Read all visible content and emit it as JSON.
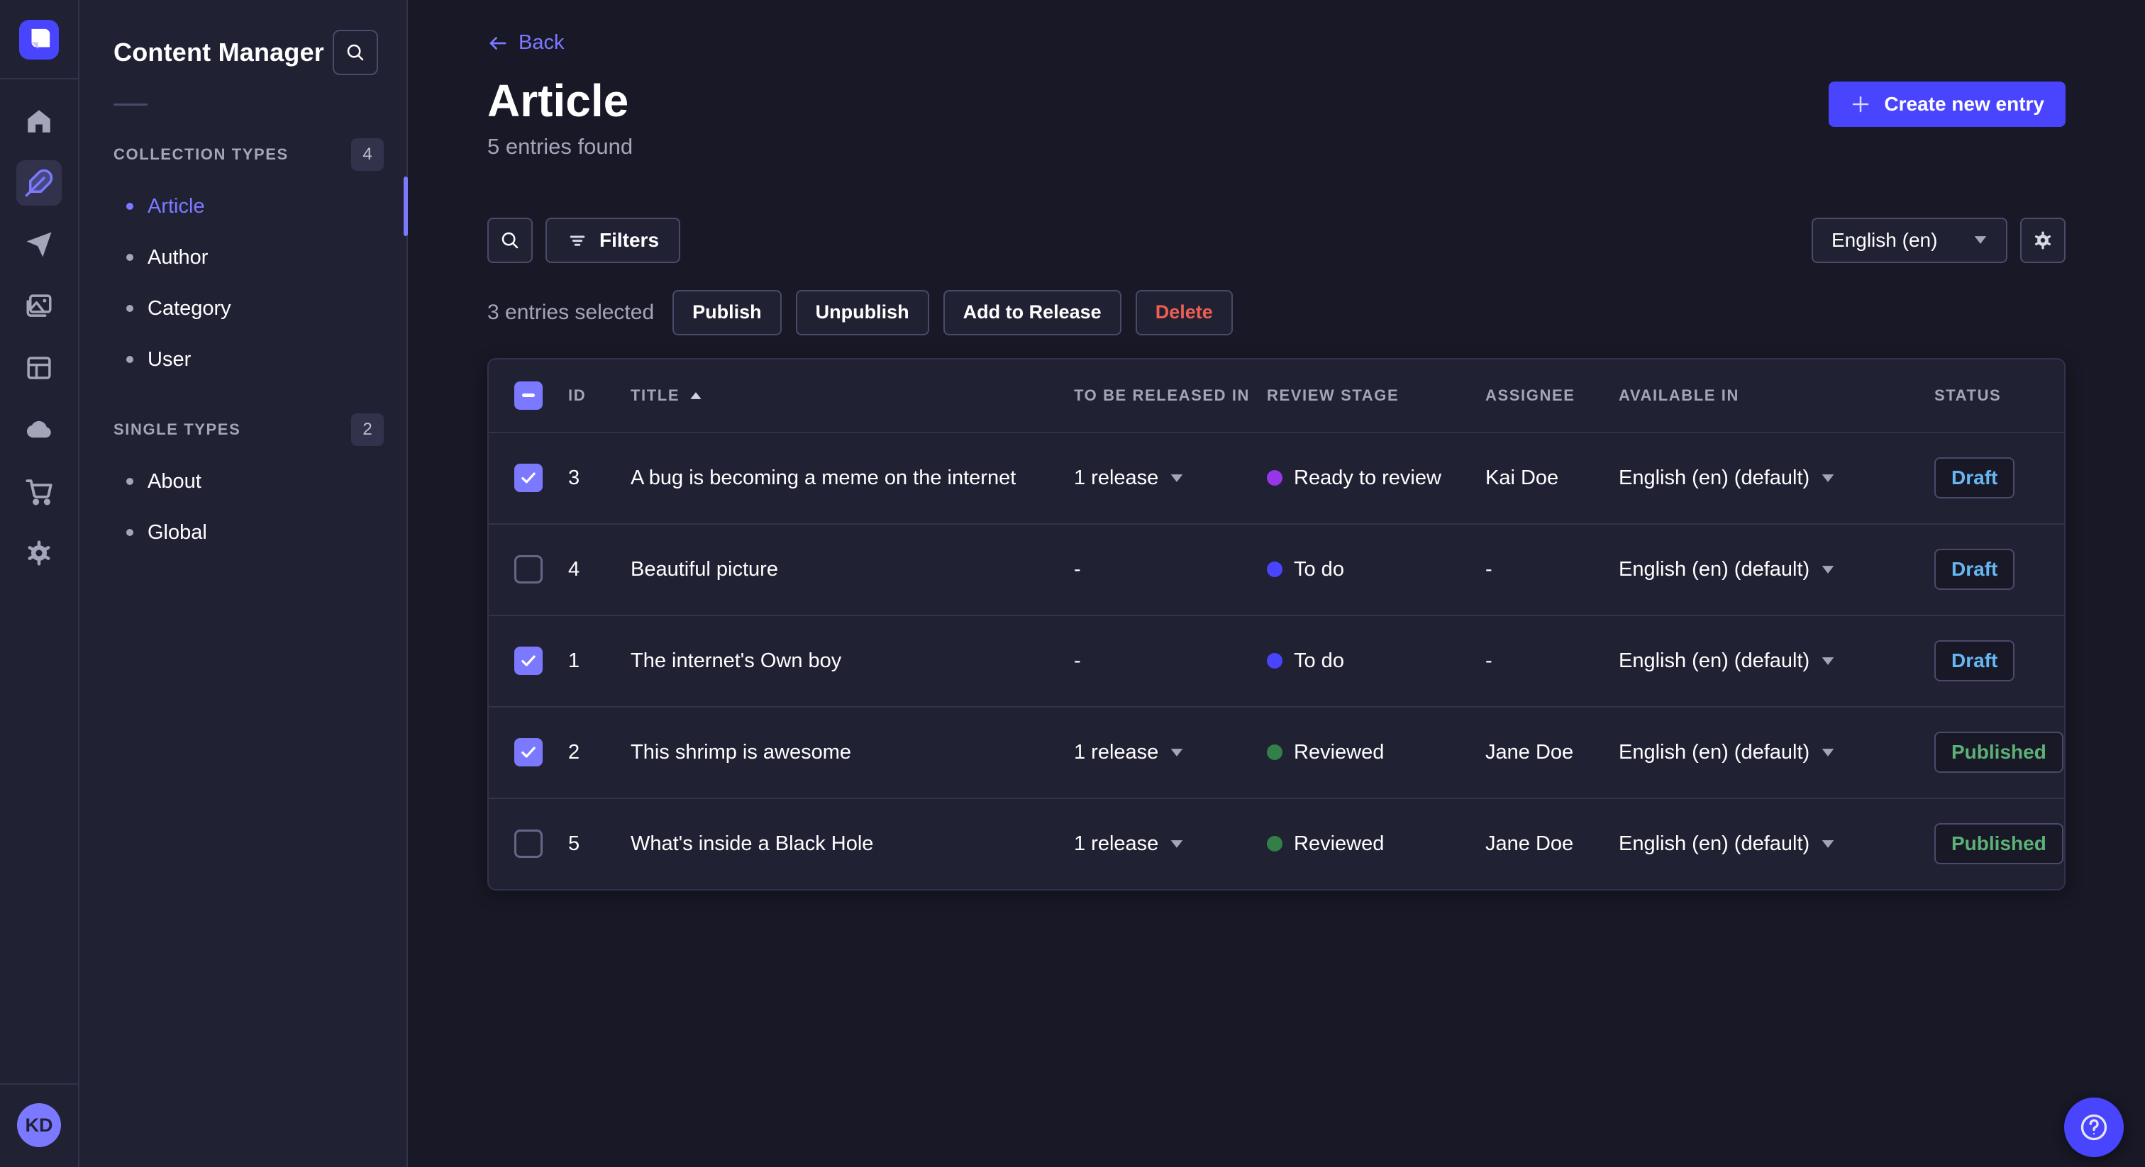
{
  "colors": {
    "primary": "#4945ff",
    "primary_light": "#7b79ff",
    "background": "#181826",
    "surface": "#212134",
    "border": "#32324d",
    "border_light": "#4a4a6a",
    "text_muted": "#a5a5ba",
    "danger": "#ee5e52",
    "status_draft": "#66b7f1",
    "status_published": "#5cb176"
  },
  "nav_rail": {
    "items": [
      {
        "name": "home",
        "active": false
      },
      {
        "name": "content-manager",
        "active": true
      },
      {
        "name": "releases",
        "active": false
      },
      {
        "name": "media-library",
        "active": false
      },
      {
        "name": "content-type-builder",
        "active": false
      },
      {
        "name": "deploy",
        "active": false
      },
      {
        "name": "marketplace",
        "active": false
      },
      {
        "name": "settings",
        "active": false
      }
    ],
    "avatar_initials": "KD"
  },
  "sidebar": {
    "title": "Content Manager",
    "sections": [
      {
        "label": "COLLECTION TYPES",
        "count": "4",
        "items": [
          {
            "label": "Article",
            "active": true
          },
          {
            "label": "Author",
            "active": false
          },
          {
            "label": "Category",
            "active": false
          },
          {
            "label": "User",
            "active": false
          }
        ]
      },
      {
        "label": "SINGLE TYPES",
        "count": "2",
        "items": [
          {
            "label": "About",
            "active": false
          },
          {
            "label": "Global",
            "active": false
          }
        ]
      }
    ]
  },
  "header": {
    "back_label": "Back",
    "title": "Article",
    "subtitle": "5 entries found",
    "create_button_label": "Create new entry"
  },
  "toolbar": {
    "filters_label": "Filters",
    "locale_selected": "English (en)"
  },
  "selection": {
    "text": "3 entries selected",
    "publish_label": "Publish",
    "unpublish_label": "Unpublish",
    "add_to_release_label": "Add to Release",
    "delete_label": "Delete"
  },
  "table": {
    "columns": [
      "ID",
      "TITLE",
      "TO BE RELEASED IN",
      "REVIEW STAGE",
      "ASSIGNEE",
      "AVAILABLE IN",
      "STATUS"
    ],
    "rows": [
      {
        "checked": true,
        "id": "3",
        "title": "A bug is becoming a meme on the internet",
        "release": "1 release",
        "has_release_menu": true,
        "stage": "Ready to review",
        "stage_color": "#9736e8",
        "assignee": "Kai Doe",
        "locale": "English (en) (default)",
        "status": "Draft",
        "status_color": "#66b7f1"
      },
      {
        "checked": false,
        "id": "4",
        "title": "Beautiful picture",
        "release": "-",
        "has_release_menu": false,
        "stage": "To do",
        "stage_color": "#4945ff",
        "assignee": "-",
        "locale": "English (en) (default)",
        "status": "Draft",
        "status_color": "#66b7f1"
      },
      {
        "checked": true,
        "id": "1",
        "title": "The internet's Own boy",
        "release": "-",
        "has_release_menu": false,
        "stage": "To do",
        "stage_color": "#4945ff",
        "assignee": "-",
        "locale": "English (en) (default)",
        "status": "Draft",
        "status_color": "#66b7f1"
      },
      {
        "checked": true,
        "id": "2",
        "title": "This shrimp is awesome",
        "release": "1 release",
        "has_release_menu": true,
        "stage": "Reviewed",
        "stage_color": "#328048",
        "assignee": "Jane Doe",
        "locale": "English (en) (default)",
        "status": "Published",
        "status_color": "#5cb176"
      },
      {
        "checked": false,
        "id": "5",
        "title": "What's inside a Black Hole",
        "release": "1 release",
        "has_release_menu": true,
        "stage": "Reviewed",
        "stage_color": "#328048",
        "assignee": "Jane Doe",
        "locale": "English (en) (default)",
        "status": "Published",
        "status_color": "#5cb176"
      }
    ]
  }
}
